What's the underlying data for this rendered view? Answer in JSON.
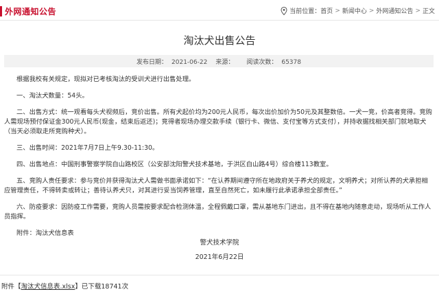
{
  "header": {
    "section_title": "外网通知公告",
    "crumbs_prefix": "当前位置：",
    "crumbs": [
      "首页",
      "新闻中心",
      "外网通知公告",
      "正文"
    ],
    "separator": ">"
  },
  "article": {
    "title": "淘汰犬出售公告",
    "publish_label": "发布日期：",
    "publish_date": "2021-06-22",
    "source_label": "来源：",
    "source_value": "",
    "views_label": "阅读次数：",
    "views_value": "65378",
    "paragraphs": [
      "根据我校有关规定，现拟对已考核淘汰的受训犬进行出售处理。",
      "一、淘汰犬数量：54头。",
      "二、出售方式：统一观看每头犬视频后，竞价出售。所有犬起价均为200元人民币，每次出价加价为50元及其整数倍。一犬一竞，价高者竞得。竞购人需现场预付保证金300元人民币(现金，结束后返还)；竞得者现场办理交款手续（银行卡、微信、支付宝等方式支付），并持收据找相关部门就地取犬（当天必须取走所竞购种犬）。",
      "三、出售时间：2021年7月7日上午9.30-11:30。",
      "四、出售地点：中国刑事警察学院白山路校区（公安部沈阳警犬技术基地，于洪区白山路4号）综合楼113教室。",
      "五、竞购人责任要求：参与竞价并获得淘汰犬人需做书面承诺如下：“在认养期间遵守所在地政府关于养犬的规定，文明养犬；对所认养的犬承担相应管理责任，不得转卖或转让；善待认养犬只，对其进行妥当饲养管理，直至自然死亡，如未履行此承诺承担全部责任。”",
      "六、防疫要求：因防疫工作需要，竞购人员需按要求配合检测体温，全程佩戴口罩，需从基地东门进出，且不得在基地内随意走动，现场听从工作人员指挥。",
      "附件：淘汰犬信息表"
    ],
    "signature": "警犬技术学院",
    "signature_date": "2021年6月22日"
  },
  "footer": {
    "attach_prefix": "附件【",
    "attach_link": "淘汰犬信息表.xlsx",
    "attach_suffix": "】已下载18741次"
  },
  "colors": {
    "accent": "#c8102e",
    "meta_bg": "#f2f2f2"
  }
}
